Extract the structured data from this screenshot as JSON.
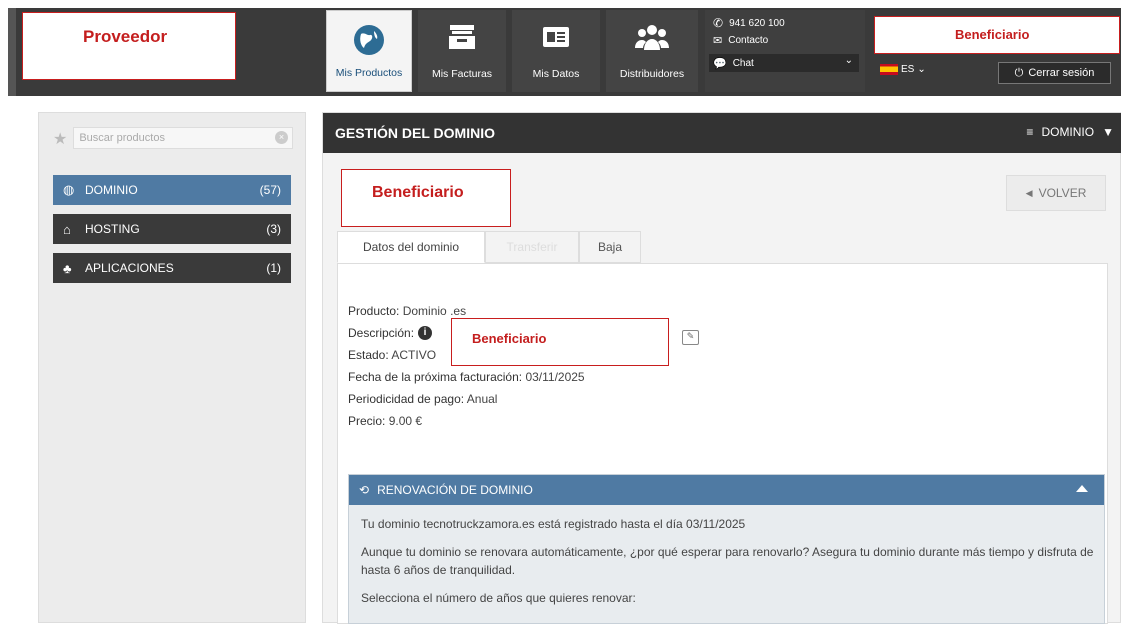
{
  "header": {
    "proveedor_label": "Proveedor",
    "nav": [
      {
        "label": "Mis Productos",
        "icon": "globe-icon"
      },
      {
        "label": "Mis Facturas",
        "icon": "invoice-tray-icon"
      },
      {
        "label": "Mis Datos",
        "icon": "id-card-icon"
      },
      {
        "label": "Distribuidores",
        "icon": "users-group-icon"
      }
    ],
    "contact": {
      "phone": "941 620 100",
      "contacto": "Contacto",
      "chat": "Chat"
    },
    "beneficiario_label": "Beneficiario",
    "language": "ES",
    "logout": "Cerrar sesión"
  },
  "sidebar": {
    "search_placeholder": "Buscar productos",
    "items": [
      {
        "label": "DOMINIO",
        "count": "(57)"
      },
      {
        "label": "HOSTING",
        "count": "(3)"
      },
      {
        "label": "APLICACIONES",
        "count": "(1)"
      }
    ]
  },
  "main": {
    "title": "GESTIÓN DEL DOMINIO",
    "menu_label": "DOMINIO",
    "beneficiario_label": "Beneficiario",
    "back": "VOLVER",
    "tabs": [
      "Datos del dominio",
      "Transferir",
      "Baja"
    ],
    "details": {
      "producto_k": "Producto:",
      "producto_v": "Dominio .es",
      "descripcion_k": "Descripción:",
      "descripcion_overlay": "Beneficiario",
      "estado_k": "Estado:",
      "estado_v": "ACTIVO",
      "fecha_k": "Fecha de la próxima facturación:",
      "fecha_v": "03/11/2025",
      "period_k": "Periodicidad de pago:",
      "period_v": "Anual",
      "precio_k": "Precio:",
      "precio_v": "9.00 €"
    },
    "renovacion": {
      "title": "RENOVACIÓN DE DOMINIO",
      "line1": "Tu dominio tecnotruckzamora.es está registrado hasta el día 03/11/2025",
      "line2": "Aunque tu dominio se renovara automáticamente, ¿por qué esperar para renovarlo? Asegura tu dominio durante más tiempo y disfruta de hasta 6 años de tranquilidad.",
      "line3": "Selecciona el número de años que quieres renovar:"
    }
  }
}
